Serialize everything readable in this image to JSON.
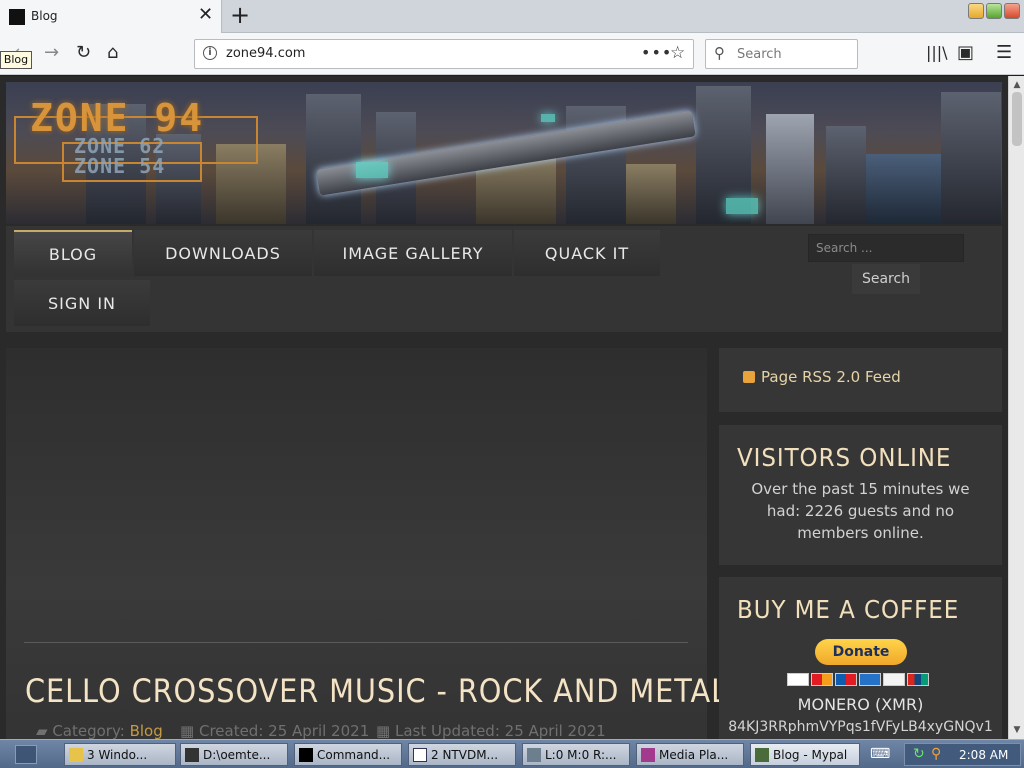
{
  "browser": {
    "tab_title": "Blog",
    "tooltip": "Blog",
    "url": "zone94.com",
    "search_placeholder": "Search",
    "icons": [
      "back-icon",
      "forward-icon",
      "reload-icon",
      "home-icon",
      "info-icon",
      "page-actions-icon",
      "bookmark-star-icon",
      "search-icon",
      "library-icon",
      "sidebar-icon",
      "menu-icon"
    ]
  },
  "site": {
    "logo_main": "ZONE 94",
    "logo_sub_1": "ZONE 62",
    "logo_sub_2": "ZONE 54",
    "menu": [
      "BLOG",
      "DOWNLOADS",
      "IMAGE GALLERY",
      "QUACK IT",
      "SIGN IN"
    ],
    "active_menu": "BLOG",
    "search_placeholder": "Search ...",
    "search_button": "Search",
    "colors": {
      "accent": "#c7a96a",
      "heading": "#f4e3c4",
      "category": "#c59b45"
    }
  },
  "article": {
    "title": "CELLO CROSSOVER MUSIC - ROCK AND METAL",
    "category_label": "Category:",
    "category_value": "Blog",
    "created": "Created: 25 April 2021",
    "updated": "Last Updated: 25 April 2021"
  },
  "sidebar": {
    "rss": "Page RSS 2.0 Feed",
    "visitors_heading": "VISITORS ONLINE",
    "visitors_text": "Over the past 15 minutes we had: 2226 guests and no members online.",
    "coffee_heading": "BUY ME A COFFEE",
    "donate_label": "Donate",
    "xmr_heading": "MONERO (XMR)",
    "xmr_address": "84KJ3RRphmVYPqs1fVFyLB4xyGNQv1"
  },
  "taskbar": {
    "items": [
      "3 Windo...",
      "D:\\oemte...",
      "Command...",
      "2 NTVDM...",
      "L:0 M:0 R:...",
      "Media Pla...",
      "Blog - Mypal"
    ],
    "clock": "2:08 AM"
  }
}
